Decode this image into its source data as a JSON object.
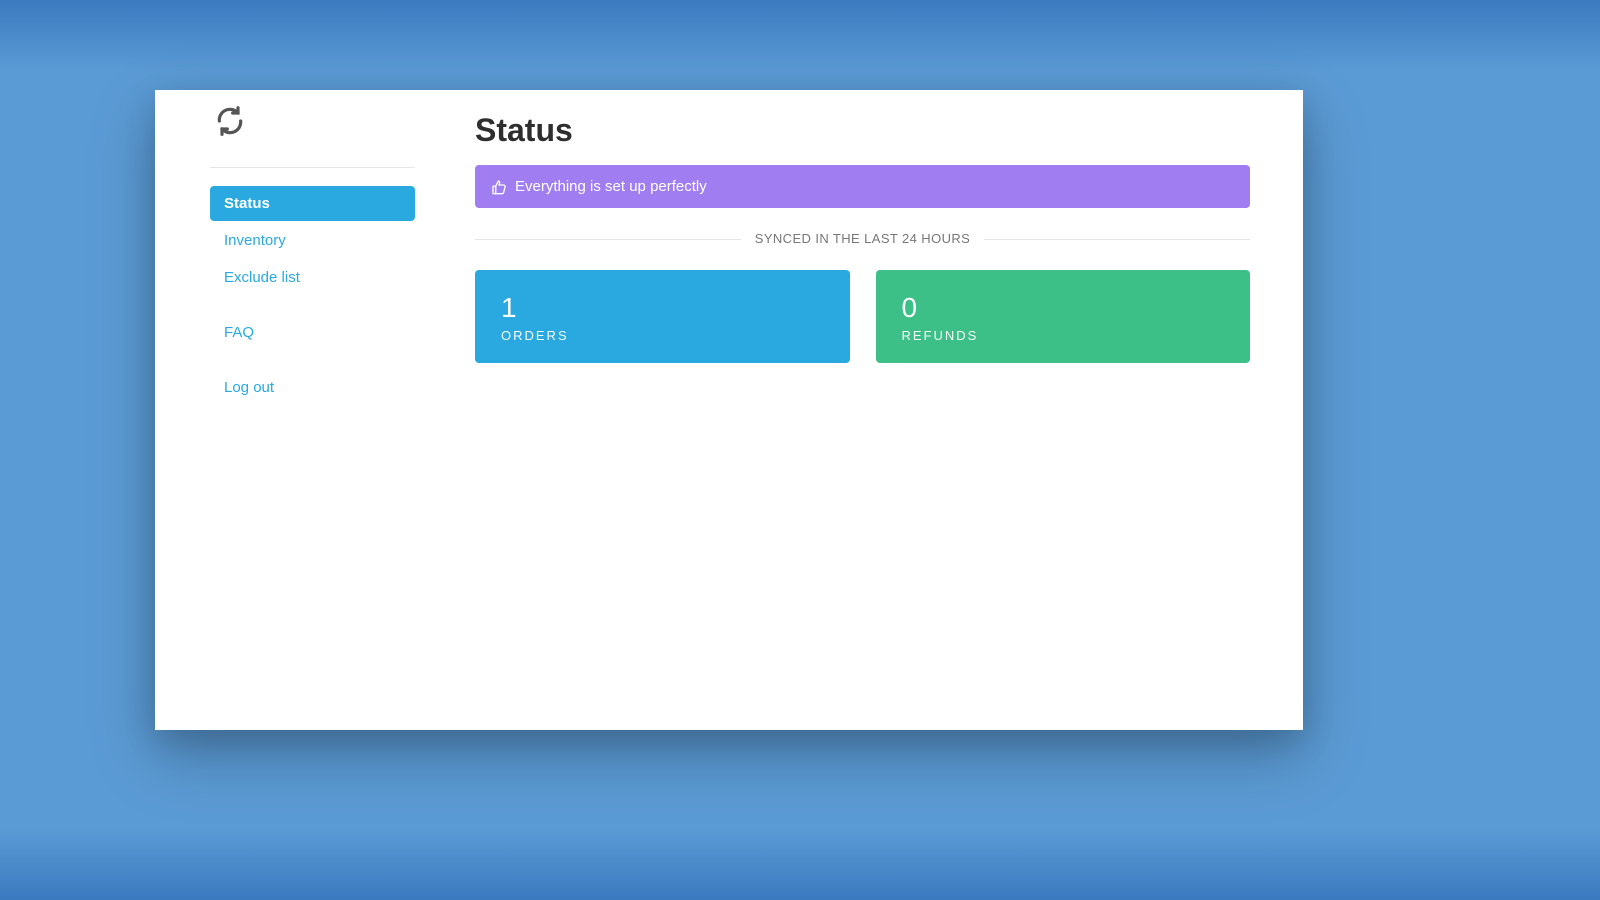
{
  "sidebar": {
    "items": [
      {
        "label": "Status",
        "active": true
      },
      {
        "label": "Inventory",
        "active": false
      },
      {
        "label": "Exclude list",
        "active": false
      },
      {
        "label": "FAQ",
        "active": false
      },
      {
        "label": "Log out",
        "active": false
      }
    ]
  },
  "page": {
    "title": "Status"
  },
  "alert": {
    "message": "Everything is set up perfectly"
  },
  "section": {
    "synced_label": "SYNCED IN THE LAST 24 HOURS"
  },
  "cards": {
    "orders": {
      "value": "1",
      "label": "ORDERS"
    },
    "refunds": {
      "value": "0",
      "label": "REFUNDS"
    }
  },
  "colors": {
    "accent_blue": "#29a9df",
    "accent_green": "#3cc088",
    "accent_purple": "#a07df1"
  }
}
